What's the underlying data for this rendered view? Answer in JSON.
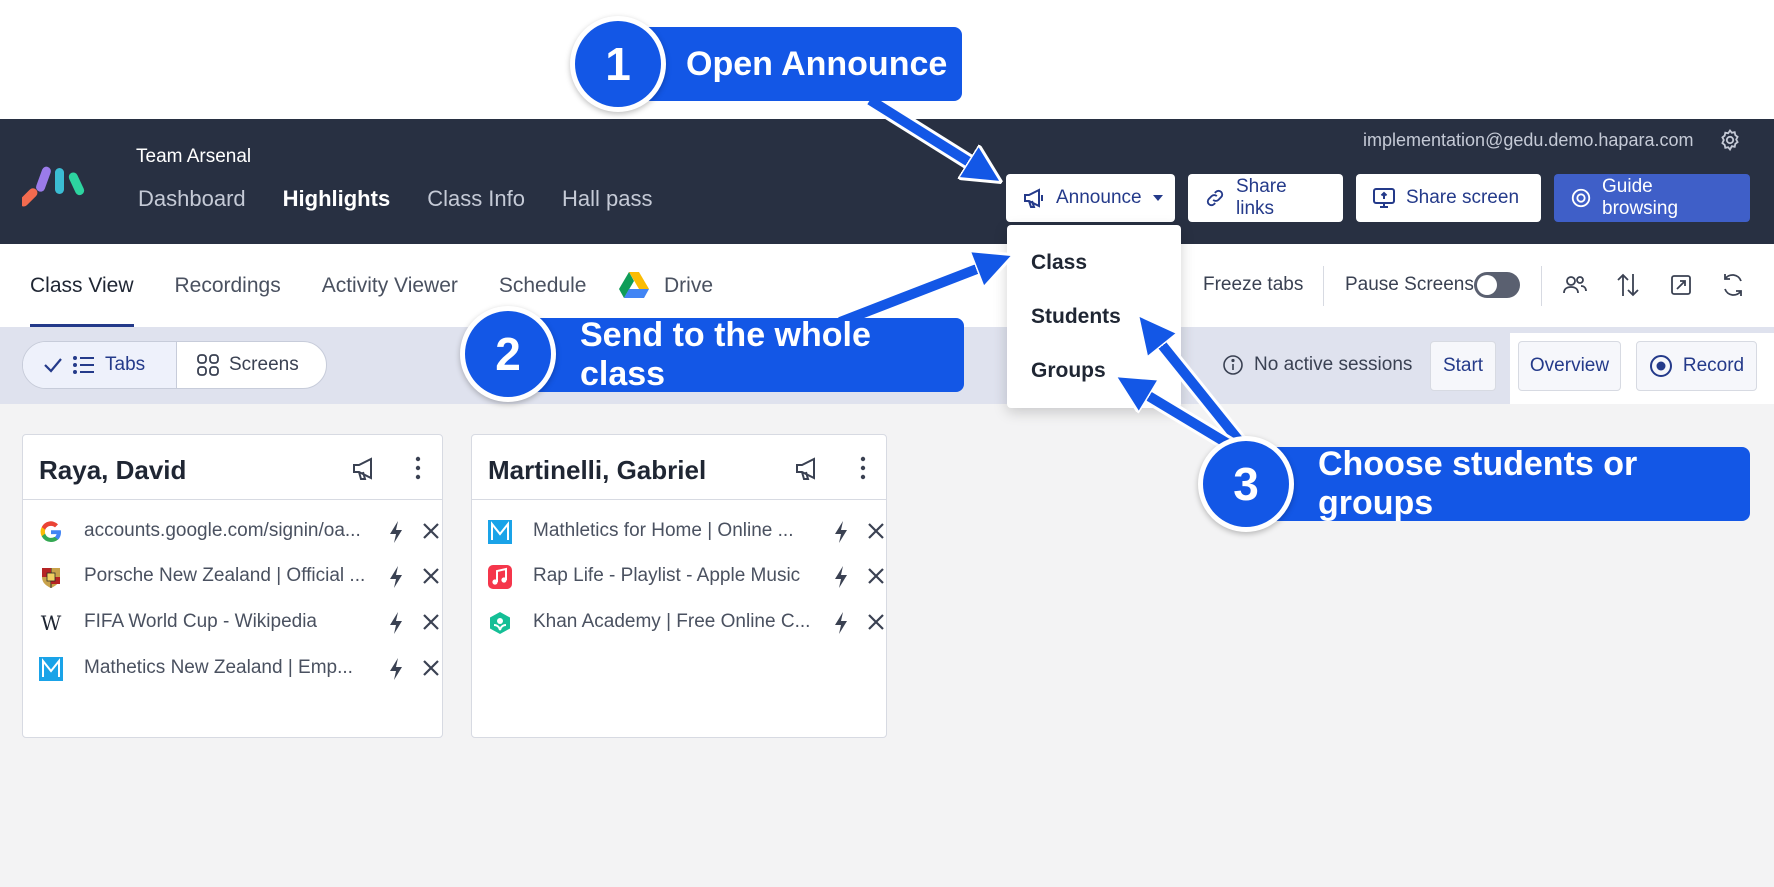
{
  "header": {
    "team_name": "Team Arsenal",
    "nav": [
      "Dashboard",
      "Highlights",
      "Class Info",
      "Hall pass"
    ],
    "active_nav": "Highlights",
    "user_email": "implementation@gedu.demo.hapara.com",
    "buttons": {
      "announce": "Announce",
      "share_links": "Share links",
      "share_screen": "Share screen",
      "guide_browsing": "Guide browsing"
    }
  },
  "announce_menu": {
    "items": [
      "Class",
      "Students",
      "Groups"
    ]
  },
  "subnav": {
    "tabs": [
      "Class View",
      "Recordings",
      "Activity Viewer",
      "Schedule",
      "Drive"
    ],
    "active": "Class View",
    "freeze_tabs": "Freeze tabs",
    "pause_screens": "Pause Screens",
    "pause_screens_on": false
  },
  "toolbar": {
    "view_tabs": "Tabs",
    "view_screens": "Screens",
    "sessions_status": "No active sessions",
    "start": "Start",
    "overview": "Overview",
    "record": "Record"
  },
  "students": [
    {
      "name": "Raya, David",
      "tabs": [
        {
          "title": "accounts.google.com/signin/oa...",
          "icon": "google-icon"
        },
        {
          "title": "Porsche New Zealand | Official ...",
          "icon": "porsche-icon"
        },
        {
          "title": "FIFA World Cup - Wikipedia",
          "icon": "wikipedia-icon"
        },
        {
          "title": "Mathetics New Zealand | Emp...",
          "icon": "mathletics-icon"
        }
      ]
    },
    {
      "name": "Martinelli, Gabriel",
      "tabs": [
        {
          "title": "Mathletics for Home | Online ...",
          "icon": "mathletics-icon"
        },
        {
          "title": "Rap Life - Playlist - Apple Music",
          "icon": "apple-music-icon"
        },
        {
          "title": "Khan Academy | Free Online C...",
          "icon": "khan-academy-icon"
        }
      ]
    }
  ],
  "callouts": {
    "step1_number": "1",
    "step1_text": "Open Announce",
    "step2_number": "2",
    "step2_text": "Send to the whole class",
    "step3_number": "3",
    "step3_text": "Choose students or groups"
  },
  "colors": {
    "navbar": "#283042",
    "accent": "#243a8a",
    "callout": "#1357e6",
    "guide_button": "#3f5fc8"
  }
}
